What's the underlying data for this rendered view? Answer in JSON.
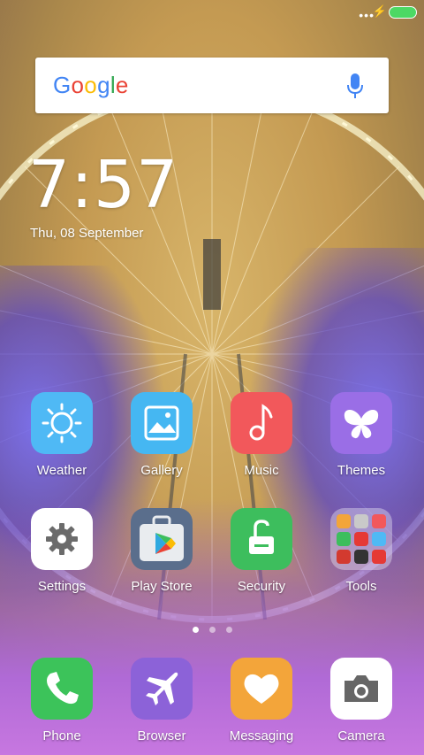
{
  "status_bar": {
    "dots": "•••",
    "charging": "⚡"
  },
  "search": {
    "logo": "Google"
  },
  "clock": {
    "time": "7:57",
    "date": "Thu, 08 September"
  },
  "apps": [
    {
      "label": "Weather",
      "color": "#4fb9f5",
      "icon": "sun-icon"
    },
    {
      "label": "Gallery",
      "color": "#45b7f2",
      "icon": "image-icon"
    },
    {
      "label": "Music",
      "color": "#f2585b",
      "icon": "music-note-icon"
    },
    {
      "label": "Themes",
      "color": "#9a6ee6",
      "icon": "butterfly-icon"
    },
    {
      "label": "Settings",
      "color": "#ffffff",
      "icon": "gear-icon"
    },
    {
      "label": "Play Store",
      "color": "#5a6e8c",
      "icon": "play-store-icon"
    },
    {
      "label": "Security",
      "color": "#3dbe5d",
      "icon": "unlock-icon"
    },
    {
      "label": "Tools",
      "color": "rgba(255,255,255,0.35)",
      "icon": "folder-icon"
    }
  ],
  "dock": [
    {
      "label": "Phone",
      "color": "#3cc35a",
      "icon": "phone-icon"
    },
    {
      "label": "Browser",
      "color": "#8c62d8",
      "icon": "airplane-icon"
    },
    {
      "label": "Messaging",
      "color": "#f3a53a",
      "icon": "heart-icon"
    },
    {
      "label": "Camera",
      "color": "#ffffff",
      "icon": "camera-icon"
    }
  ],
  "pager": {
    "pages": 3,
    "current": 1
  }
}
